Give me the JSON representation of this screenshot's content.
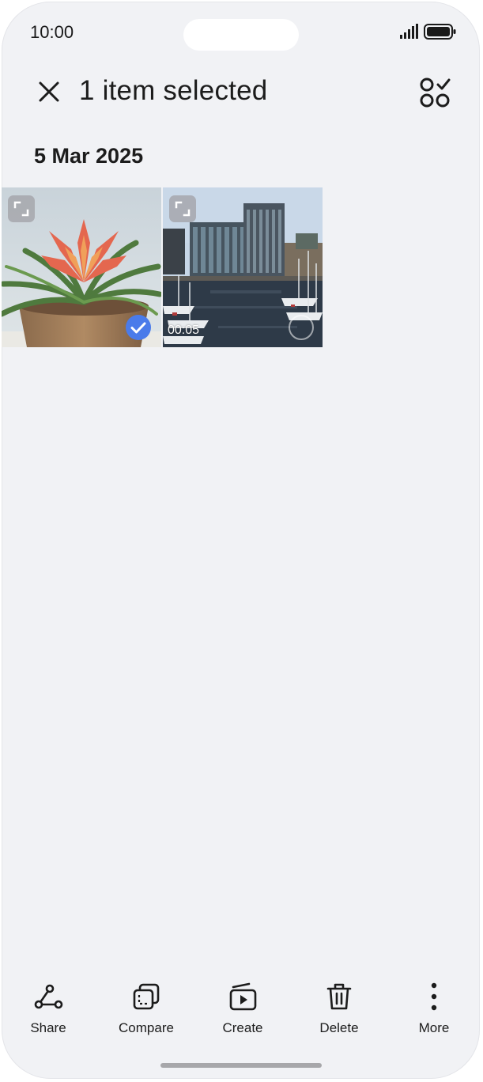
{
  "status_bar": {
    "time": "10:00"
  },
  "header": {
    "title": "1 item selected"
  },
  "section": {
    "date": "5 Mar 2025"
  },
  "items": [
    {
      "type": "photo",
      "selected": true
    },
    {
      "type": "video",
      "duration": "00:05",
      "selected": false
    }
  ],
  "actions": [
    {
      "label": "Share",
      "icon": "share-icon"
    },
    {
      "label": "Compare",
      "icon": "compare-icon"
    },
    {
      "label": "Create",
      "icon": "create-icon"
    },
    {
      "label": "Delete",
      "icon": "trash-icon"
    },
    {
      "label": "More",
      "icon": "more-vertical-icon"
    }
  ],
  "colors": {
    "accent": "#4a7bea",
    "background": "#f1f2f5"
  }
}
